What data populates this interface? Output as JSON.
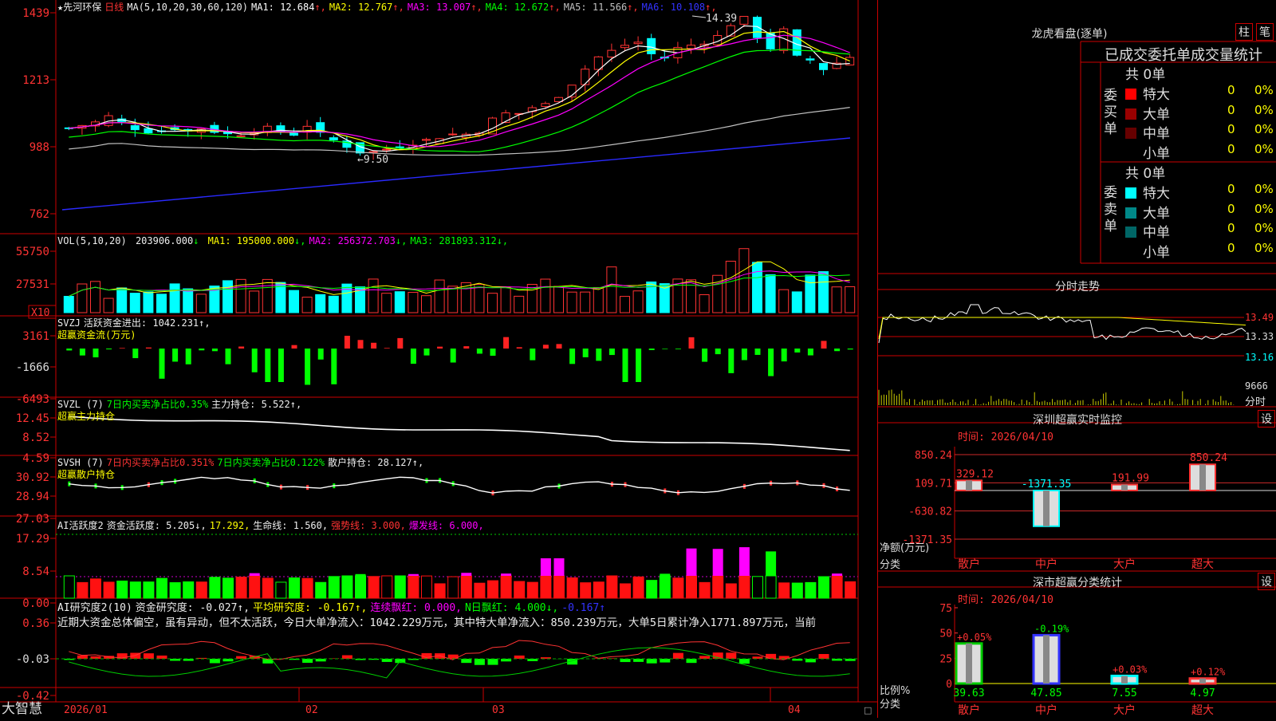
{
  "stock": {
    "name": "★先河环保",
    "period": "日线"
  },
  "panels": {
    "main": {
      "ma_label": "MA(5,10,20,30,60,120)",
      "ma": [
        {
          "name": "MA1",
          "value": "12.684",
          "arrow": "↑",
          "color": "#ffffff"
        },
        {
          "name": "MA2",
          "value": "12.767",
          "arrow": "↑",
          "color": "#ffff00"
        },
        {
          "name": "MA3",
          "value": "13.007",
          "arrow": "↑",
          "color": "#ff00ff"
        },
        {
          "name": "MA4",
          "value": "12.672",
          "arrow": "↑",
          "color": "#00ff00"
        },
        {
          "name": "MA5",
          "value": "11.566",
          "arrow": "↑",
          "color": "#c0c0c0"
        },
        {
          "name": "MA6",
          "value": "10.108",
          "arrow": "↑",
          "color": "#3333ff"
        }
      ],
      "y_ticks": [
        "1439",
        "1213",
        "988",
        "762"
      ],
      "high_label": "14.39",
      "low_label": "←9.50"
    },
    "vol": {
      "label": "VOL(5,10,20)",
      "value": "203906.000",
      "value_arrow": "↓",
      "ma": [
        {
          "name": "MA1",
          "value": "195000.000",
          "arrow": "↓",
          "color": "#ffff00"
        },
        {
          "name": "MA2",
          "value": "256372.703",
          "arrow": "↓",
          "color": "#ff00ff"
        },
        {
          "name": "MA3",
          "value": "281893.312",
          "arrow": "↓",
          "color": "#00ff00"
        }
      ],
      "y_ticks": [
        "55750",
        "27531"
      ],
      "unit": "X10"
    },
    "svzj": {
      "label": "SVZJ",
      "line1": "活跃资金进出: 1042.231↑,",
      "line2": "超赢资金流(万元)",
      "y_ticks": [
        "3161",
        "-1666",
        "-6493"
      ]
    },
    "svzl": {
      "label": "SVZL (7)",
      "part1": "7日内买卖净占比0.35%",
      "part2": "主力持仓: 5.522↑,",
      "line2": "超赢主力持仓",
      "y_ticks": [
        "12.45",
        "8.52",
        "4.59"
      ]
    },
    "svsh": {
      "label": "SVSH (7)",
      "part1": "7日内买卖净占比0.351%",
      "part2": "7日内买卖净占比0.122%",
      "part3": "散户持仓: 28.127↑,",
      "line2": "超赢散户持仓",
      "y_ticks": [
        "30.92",
        "28.94",
        "27.03"
      ]
    },
    "ai1": {
      "label": "AI活跃度2",
      "part1": "资金活跃度: 5.205↓,",
      "part2": "17.292,",
      "part3": "生命线: 1.560,",
      "part4": "强势线: 3.000,",
      "part5": "爆发线: 6.000,",
      "y_ticks": [
        "17.29",
        "8.54",
        "0.00"
      ]
    },
    "ai2": {
      "label": "AI研究度2(10)",
      "part1": "资金研究度: -0.027↑,",
      "part2": "平均研究度: -0.167↑,",
      "part3": "连续飘红: 0.000,",
      "part4": "N日飘红: 4.000↓,",
      "part5": "-0.167↑",
      "commentary": "近期大资金总体偏空，虽有异动，但不太活跃，今日大单净流入：1042.229万元，其中特大单净流入：850.239万元，大单5日累计净入1771.897万元，当前",
      "y_ticks": [
        "0.36",
        "-0.03",
        "-0.42"
      ]
    }
  },
  "bottom": {
    "brand": "大智慧",
    "dates": [
      "2026/01",
      "02",
      "03",
      "04"
    ]
  },
  "right": {
    "longhu": {
      "title": "龙虎看盘(逐单)",
      "btn1": "柱",
      "btn2": "笔",
      "subtitle": "已成交委托单成交量统计",
      "buy_label": [
        "委",
        "买",
        "单"
      ],
      "sell_label": [
        "委",
        "卖",
        "单"
      ],
      "buy_total": "共 0单",
      "sell_total": "共 0单",
      "buy_rows": [
        {
          "label": "特大",
          "count": "0",
          "pct": "0%",
          "color": "#ff0000"
        },
        {
          "label": "大单",
          "count": "0",
          "pct": "0%",
          "color": "#990000"
        },
        {
          "label": "中单",
          "count": "0",
          "pct": "0%",
          "color": "#660000"
        },
        {
          "label": "小单",
          "count": "0",
          "pct": "0%",
          "color": ""
        }
      ],
      "sell_rows": [
        {
          "label": "特大",
          "count": "0",
          "pct": "0%",
          "color": "#00ffff"
        },
        {
          "label": "大单",
          "count": "0",
          "pct": "0%",
          "color": "#008888"
        },
        {
          "label": "中单",
          "count": "0",
          "pct": "0%",
          "color": "#006666"
        },
        {
          "label": "小单",
          "count": "0",
          "pct": "0%",
          "color": ""
        }
      ]
    },
    "intraday": {
      "title": "分时走势",
      "y_ticks": [
        "13.49",
        "13.33",
        "13.16"
      ],
      "vol_tick": "9666",
      "vol_label": "分时"
    },
    "monitor": {
      "title": "深圳超赢实时监控",
      "settings": "设",
      "time": "时间: 2026/04/10",
      "y_ticks": [
        "850.24",
        "109.71",
        "-630.82",
        "-1371.35"
      ],
      "ylabel": "净额(万元)",
      "xlabel": "分类",
      "categories": [
        "散户",
        "中户",
        "大户",
        "超大"
      ],
      "values": [
        329.12,
        -1371.35,
        191.99,
        850.24
      ],
      "value_labels": [
        "329.12",
        "-1371.35",
        "191.99",
        "850.24"
      ]
    },
    "classify": {
      "title": "深市超赢分类统计",
      "settings": "设",
      "time": "时间: 2026/04/10",
      "y_ticks": [
        "75",
        "50",
        "25",
        "0"
      ],
      "ylabel": "比例%",
      "xlabel": "分类",
      "categories": [
        "散户",
        "中户",
        "大户",
        "超大"
      ],
      "values": [
        39.63,
        47.85,
        7.55,
        4.97
      ],
      "changes": [
        "+0.05%",
        "-0.19%",
        "+0.03%",
        "+0.12%"
      ]
    }
  },
  "chart_data": [
    {
      "type": "line",
      "title": "先河环保 日线",
      "x": [
        "2026/01",
        "02",
        "03",
        "04"
      ],
      "ylim": [
        7.62,
        14.39
      ],
      "series": [
        {
          "name": "MA1",
          "values": [
            12.684
          ]
        },
        {
          "name": "MA2",
          "values": [
            12.767
          ]
        },
        {
          "name": "MA3",
          "values": [
            13.007
          ]
        },
        {
          "name": "MA4",
          "values": [
            12.672
          ]
        },
        {
          "name": "MA5",
          "values": [
            11.566
          ]
        },
        {
          "name": "MA6",
          "values": [
            10.108
          ]
        }
      ]
    },
    {
      "type": "bar",
      "title": "深圳超赢实时监控",
      "categories": [
        "散户",
        "中户",
        "大户",
        "超大"
      ],
      "values": [
        329.12,
        -1371.35,
        191.99,
        850.24
      ],
      "ylabel": "净额(万元)",
      "xlabel": "分类",
      "ylim": [
        -1371.35,
        850.24
      ]
    },
    {
      "type": "bar",
      "title": "深市超赢分类统计",
      "categories": [
        "散户",
        "中户",
        "大户",
        "超大"
      ],
      "values": [
        39.63,
        47.85,
        7.55,
        4.97
      ],
      "ylabel": "比例%",
      "xlabel": "分类",
      "ylim": [
        0,
        75
      ]
    }
  ]
}
